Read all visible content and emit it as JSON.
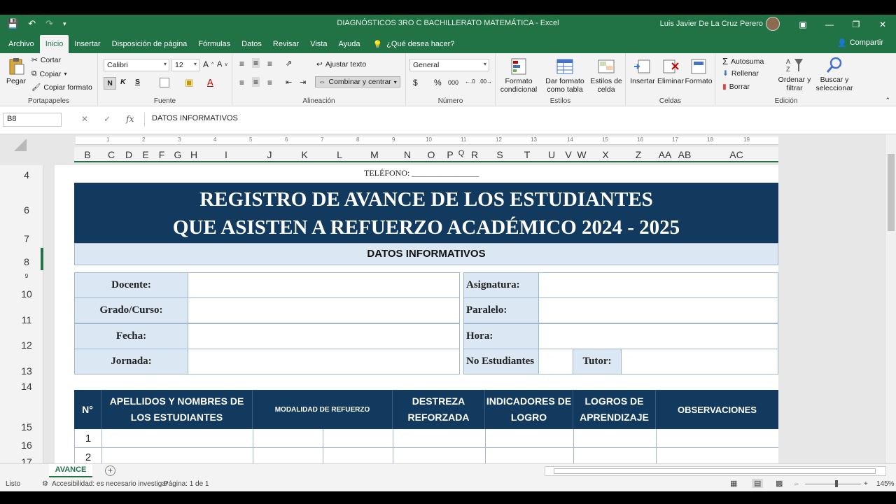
{
  "window": {
    "title": "DIAGNÓSTICOS 3RO C BACHILLERATO MATEMÁTICA  -  Excel",
    "user": "Luis Javier De La Cruz Perero"
  },
  "menu": {
    "tabs": [
      "Archivo",
      "Inicio",
      "Insertar",
      "Disposición de página",
      "Fórmulas",
      "Datos",
      "Revisar",
      "Vista",
      "Ayuda"
    ],
    "tell_me": "¿Qué desea hacer?",
    "share": "Compartir"
  },
  "ribbon": {
    "clipboard": {
      "paste": "Pegar",
      "cut": "Cortar",
      "copy": "Copiar",
      "format_painter": "Copiar formato",
      "label": "Portapapeles"
    },
    "font": {
      "name": "Calibri",
      "size": "12",
      "bold": "N",
      "italic": "K",
      "underline": "S",
      "label": "Fuente"
    },
    "alignment": {
      "wrap": "Ajustar texto",
      "merge": "Combinar y centrar",
      "label": "Alineación"
    },
    "number": {
      "format": "General",
      "currency": "$",
      "percent": "%",
      "thousands": "000",
      "label": "Número"
    },
    "styles": {
      "cond": "Formato condicional",
      "table": "Dar formato como tabla",
      "cell": "Estilos de celda",
      "label": "Estilos"
    },
    "cells": {
      "insert": "Insertar",
      "delete": "Eliminar",
      "format": "Formato",
      "label": "Celdas"
    },
    "editing": {
      "autosum": "Autosuma",
      "fill": "Rellenar",
      "clear": "Borrar",
      "sort": "Ordenar y filtrar",
      "find": "Buscar y seleccionar",
      "label": "Edición"
    }
  },
  "formula_bar": {
    "name_box": "B8",
    "fx": "fx",
    "content": "DATOS INFORMATIVOS"
  },
  "ruler": [
    "1",
    "2",
    "3",
    "4",
    "5",
    "6",
    "7",
    "8",
    "9",
    "10",
    "11",
    "12",
    "13",
    "14",
    "15",
    "16",
    "17",
    "18",
    "19"
  ],
  "columns": [
    "B",
    "C",
    "D",
    "E",
    "F",
    "G",
    "H",
    "I",
    "J",
    "K",
    "L",
    "M",
    "N",
    "O",
    "P",
    "Q",
    "R",
    "S",
    "T",
    "U",
    "V",
    "W",
    "X",
    "Z",
    "AA",
    "AB",
    "AC"
  ],
  "rows": [
    "4",
    "6",
    "7",
    "8",
    "9",
    "10",
    "11",
    "12",
    "13",
    "14",
    "15",
    "16",
    "17"
  ],
  "sheet": {
    "telefono": "TELÉFONO: ________________",
    "banner_line1": "REGISTRO DE AVANCE DE LOS ESTUDIANTES",
    "banner_line2": "QUE ASISTEN A REFUERZO ACADÉMICO 2024 - 2025",
    "datos": "DATOS INFORMATIVOS",
    "left_labels": [
      "Docente:",
      "Grado/Curso:",
      "Fecha:",
      "Jornada:"
    ],
    "right_labels": [
      "Asignatura:",
      "Paralelo:",
      "Hora:",
      "No  Estudiantes"
    ],
    "tutor": "Tutor:",
    "table_headers": {
      "n": "N°",
      "names": "APELLIDOS Y NOMBRES DE LOS ESTUDIANTES",
      "modalidad": "MODALIDAD DE REFUERZO",
      "destreza": "DESTREZA REFORZADA",
      "indicadores": "INDICADORES DE LOGRO",
      "logros": "LOGROS DE APRENDIZAJE",
      "observaciones": "OBSERVACIONES"
    },
    "row_numbers": [
      "1",
      "2"
    ]
  },
  "sheet_tab": "AVANCE",
  "status": {
    "ready": "Listo",
    "accessibility": "Accesibilidad: es necesario investigar",
    "page": "Página: 1 de 1",
    "zoom": "145%"
  },
  "colors": {
    "excel_green": "#217346",
    "banner_navy": "#12395e",
    "label_blue": "#dbe7f3"
  }
}
